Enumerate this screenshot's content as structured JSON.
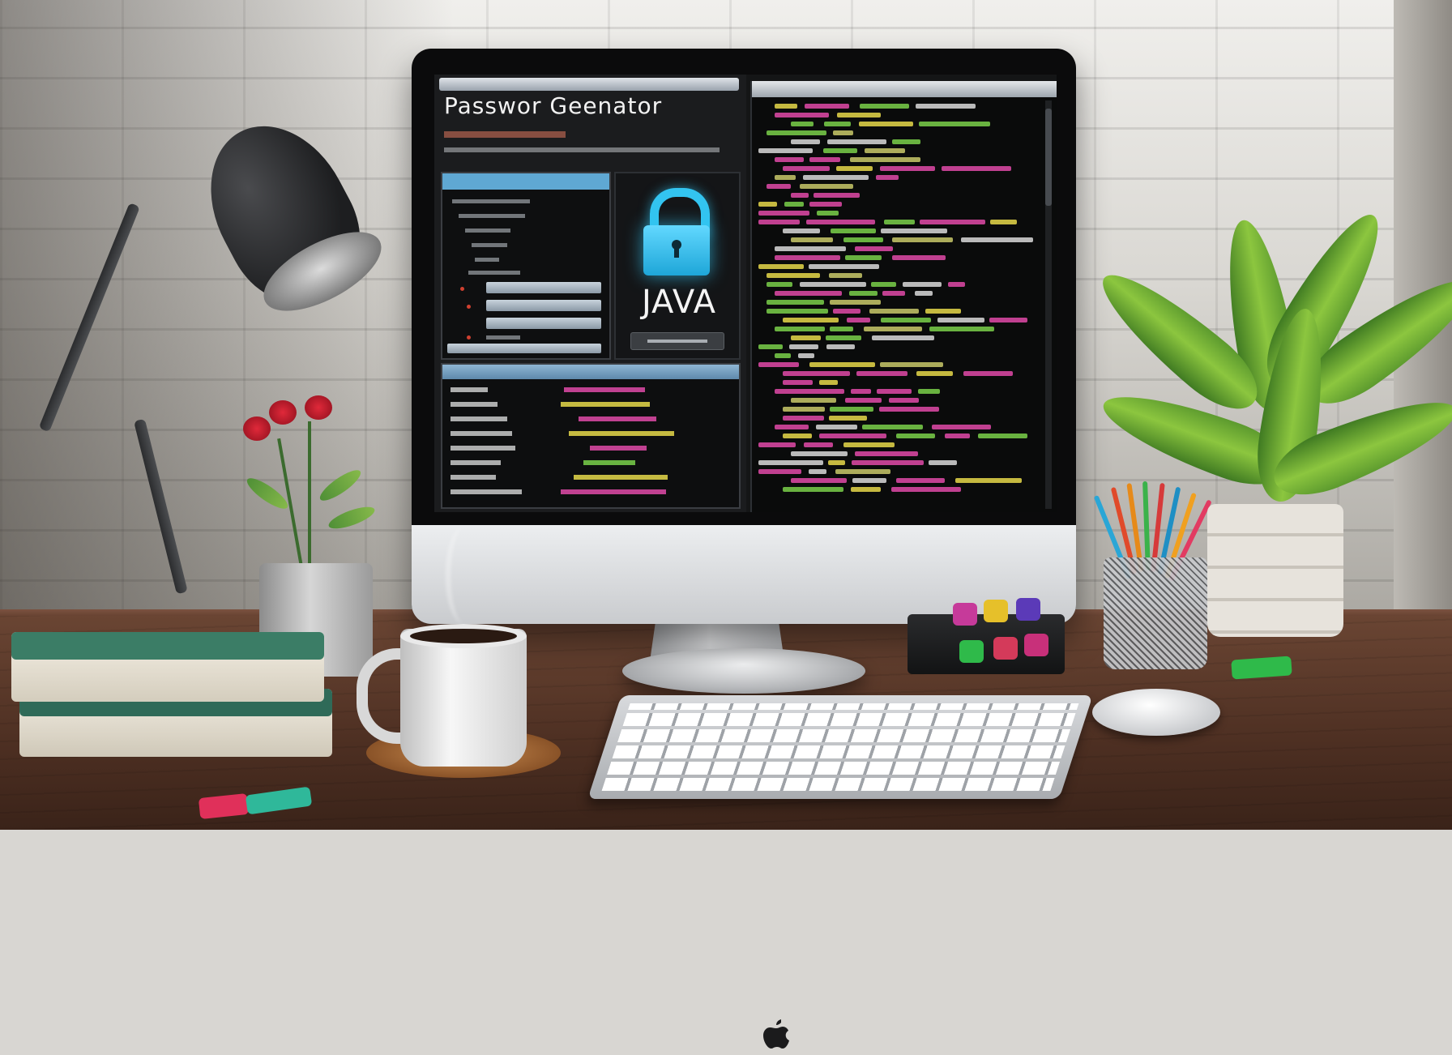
{
  "scene": {
    "description_colors": {
      "wall": "#e6e4e0",
      "desk": "#5a3828",
      "accent_blue": "#33c4f0",
      "code_pink": "#e04aa8",
      "code_yellow": "#e6d84a",
      "code_green": "#7ad04a"
    }
  },
  "app": {
    "title": "Passwor Geenator"
  },
  "lock_panel": {
    "icon": "lock-icon",
    "label": "JAVA"
  },
  "monitor": {
    "brand_icon": "apple-logo-icon"
  }
}
